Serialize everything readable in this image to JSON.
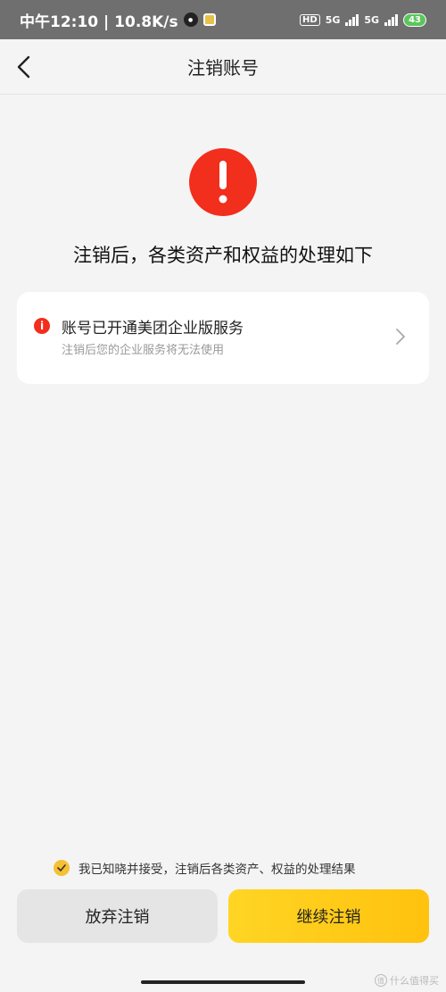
{
  "status_bar": {
    "time_speed": "中午12:10 | 10.8K/s",
    "hd": "HD",
    "net1": "5G",
    "net2": "5G",
    "battery": "43"
  },
  "nav": {
    "title": "注销账号"
  },
  "heading": "注销后，各类资产和权益的处理如下",
  "card": {
    "warn_glyph": "i",
    "title": "账号已开通美团企业版服务",
    "subtitle": "注销后您的企业服务将无法使用"
  },
  "agreement": {
    "text": "我已知晓并接受，注销后各类资产、权益的处理结果",
    "checked": true
  },
  "buttons": {
    "cancel": "放弃注销",
    "continue": "继续注销"
  },
  "watermark": {
    "badge": "值",
    "text": "什么值得买"
  },
  "colors": {
    "alert_red": "#f22e1c",
    "accent_yellow": "#ffc20e",
    "background": "#f4f4f4"
  }
}
